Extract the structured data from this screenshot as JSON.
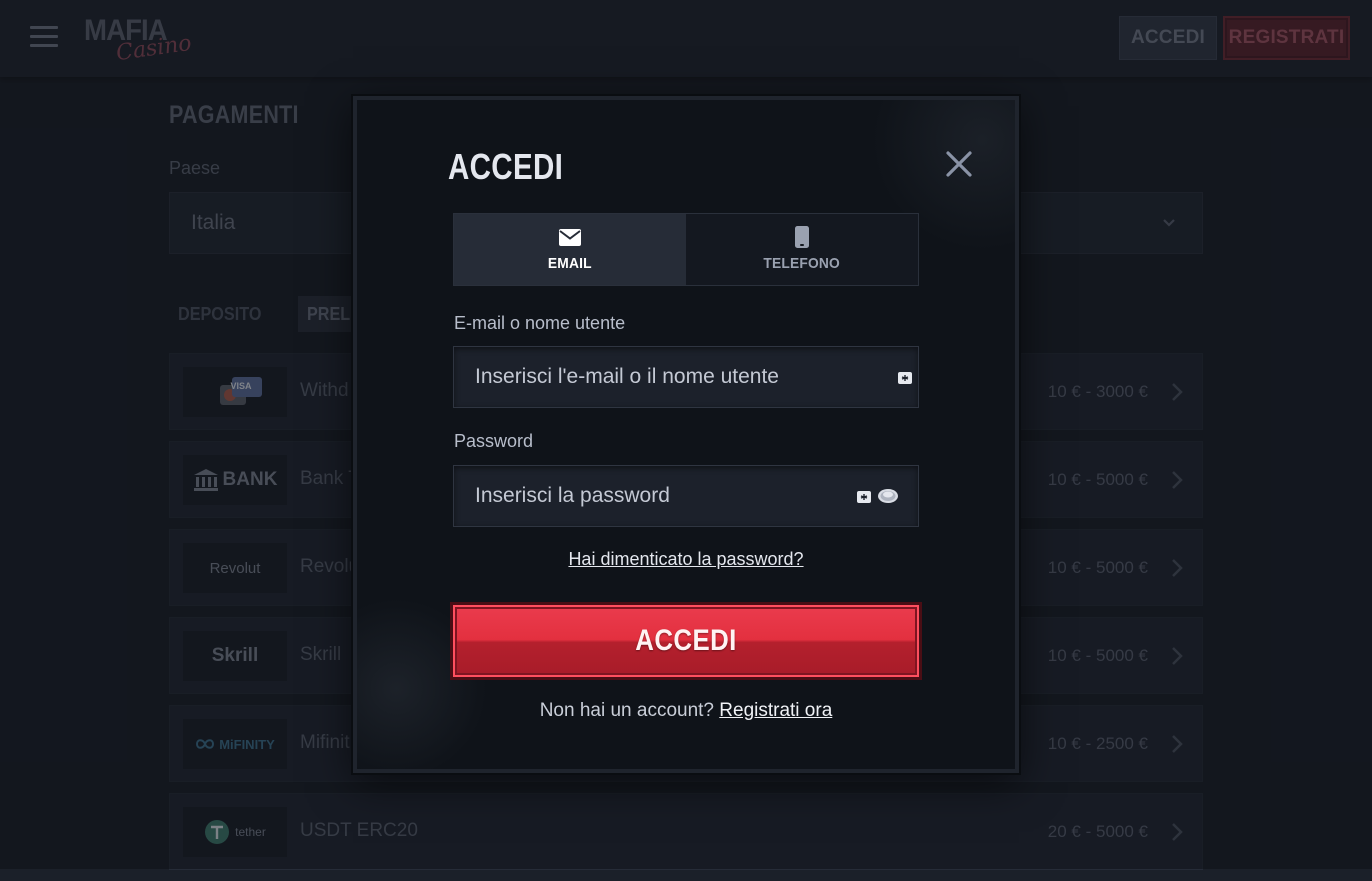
{
  "header": {
    "logo_main": "MAFIA",
    "logo_sub": "Casino",
    "login_label": "ACCEDI",
    "register_label": "REGISTRATI"
  },
  "page": {
    "title": "PAGAMENTI",
    "country_label": "Paese",
    "country_value": "Italia",
    "tabs": [
      {
        "label": "DEPOSITO",
        "active": false
      },
      {
        "label": "PRELIEVO",
        "active": true
      }
    ],
    "methods": [
      {
        "logo": "VISA",
        "name": "Withd",
        "range": "10 € - 3000 €"
      },
      {
        "logo": "BANK",
        "name": "Bank T",
        "range": "10 € - 5000 €"
      },
      {
        "logo": "Revolut",
        "name": "Revolu",
        "range": "10 € - 5000 €"
      },
      {
        "logo": "Skrill",
        "name": "Skrill",
        "range": "10 € - 5000 €"
      },
      {
        "logo": "MiFINITY",
        "name": "Mifinit",
        "range": "10 € - 2500 €"
      },
      {
        "logo": "tether",
        "name": "USDT ERC20",
        "range": "20 € - 5000 €"
      }
    ]
  },
  "modal": {
    "title": "ACCEDI",
    "tabs": [
      {
        "label": "EMAIL",
        "icon": "envelope-icon",
        "active": true
      },
      {
        "label": "TELEFONO",
        "icon": "phone-icon",
        "active": false
      }
    ],
    "email": {
      "label": "E-mail o nome utente",
      "placeholder": "Inserisci l'e-mail o il nome utente"
    },
    "password": {
      "label": "Password",
      "placeholder": "Inserisci la password"
    },
    "forgot_label": "Hai dimenticato la password?",
    "submit_label": "ACCEDI",
    "signup_prompt": "Non hai un account?",
    "signup_link": "Registrati ora"
  },
  "colors": {
    "accent_red": "#e3303f",
    "background": "#1b2029",
    "modal_bg": "#0f1319"
  }
}
